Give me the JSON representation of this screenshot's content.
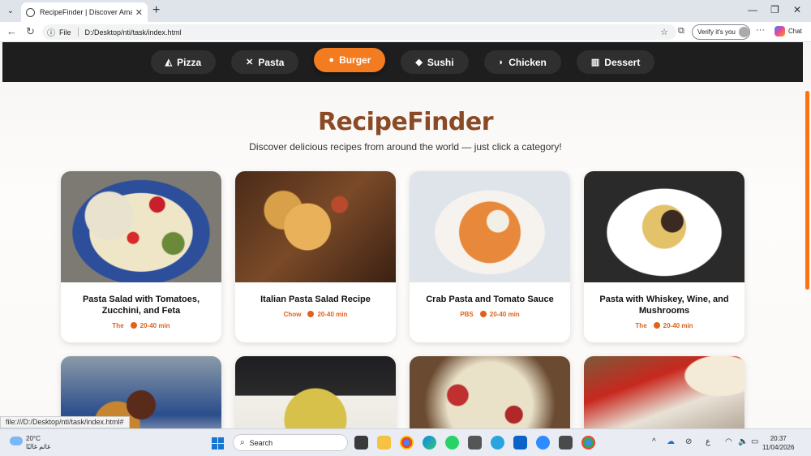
{
  "browser": {
    "tab_title": "RecipeFinder | Discover Amazing R",
    "url_scheme": "File",
    "url": "D:/Desktop/nti/task/index.html",
    "verify_label": "Verify it's you",
    "copilot_label": "Chat"
  },
  "nav": {
    "items": [
      {
        "label": "Pizza",
        "icon": "pizza-icon",
        "glyph": "◭"
      },
      {
        "label": "Pasta",
        "icon": "fork-knife-icon",
        "glyph": "🍴"
      },
      {
        "label": "Burger",
        "icon": "burger-icon",
        "glyph": "●"
      },
      {
        "label": "Sushi",
        "icon": "fish-icon",
        "glyph": "◆"
      },
      {
        "label": "Chicken",
        "icon": "drumstick-icon",
        "glyph": "◗"
      },
      {
        "label": "Dessert",
        "icon": "cake-icon",
        "glyph": "▥"
      }
    ],
    "active": "Burger"
  },
  "hero": {
    "title": "RecipeFinder",
    "subtitle": "Discover delicious recipes from around the world — just click a category!"
  },
  "recipes": [
    {
      "name": "Pasta Salad with Tomatoes, Zucchini, and Feta",
      "source": "The",
      "time": "20-40 min"
    },
    {
      "name": "Italian Pasta Salad Recipe",
      "source": "Chow",
      "time": "20-40 min"
    },
    {
      "name": "Crab Pasta and Tomato Sauce",
      "source": "PBS",
      "time": "20-40 min"
    },
    {
      "name": "Pasta with Whiskey, Wine, and Mushrooms",
      "source": "The",
      "time": "20-40 min"
    }
  ],
  "status_link": "file:///D:/Desktop/nti/task/index.html#",
  "taskbar": {
    "weather_temp": "20°C",
    "weather_text": "غائم غالبًا",
    "search_label": "Search",
    "lang": "ع",
    "time": "20:37",
    "date": "11/04/2026"
  }
}
